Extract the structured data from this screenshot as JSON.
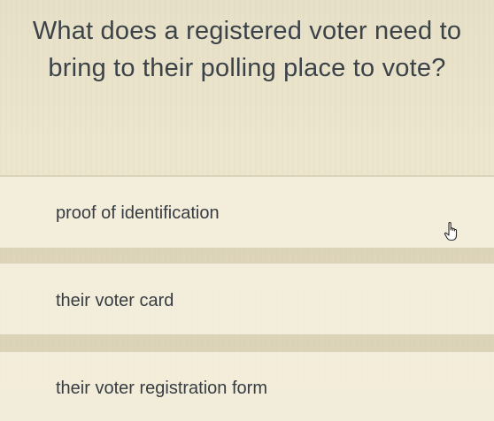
{
  "question": {
    "text": "What does a registered voter need to bring to their polling place to vote?"
  },
  "options": [
    {
      "label": "proof of identification"
    },
    {
      "label": "their voter card"
    },
    {
      "label": "their voter registration form"
    }
  ],
  "cursor": {
    "icon": "hand-pointer-icon"
  },
  "colors": {
    "background": "#e8e2ca",
    "text": "#363c42"
  }
}
